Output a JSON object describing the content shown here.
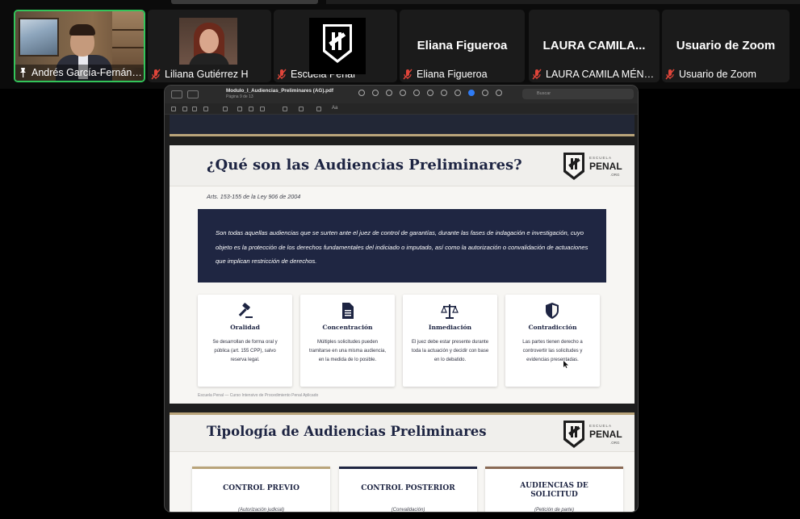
{
  "participants": [
    {
      "name": "Andrés García-Fernán…",
      "video": true,
      "pinned": true,
      "muted": false,
      "active_speaker": true
    },
    {
      "name": "Liliana Gutiérrez H",
      "video": true,
      "muted": true
    },
    {
      "name": "Escuela Penal",
      "video": false,
      "logo": true,
      "muted": true
    },
    {
      "name": "Eliana Figueroa",
      "display_name": "Eliana Figueroa",
      "video": false,
      "muted": true
    },
    {
      "name": "LAURA CAMILA MÉN…",
      "display_name": "LAURA CAMILA...",
      "video": false,
      "muted": true
    },
    {
      "name": "Usuario de Zoom",
      "display_name": "Usuario de Zoom",
      "video": false,
      "muted": true
    }
  ],
  "viewer": {
    "filename": "Modulo_I_Audiencias_Preliminares (AG).pdf",
    "page_info": "Página 9 de 13",
    "search_placeholder": "Buscar",
    "text_size_label": "Aa"
  },
  "slide1": {
    "title": "¿Qué son las Audiencias Preliminares?",
    "logo_top": "ESCUELA",
    "logo_main": "PENAL",
    "logo_sub": ".ORG",
    "legal_ref": "Arts. 153-155 de la Ley 906 de 2004",
    "definition": "Son todas aquellas audiencias que se surten ante el juez de control de garantías, durante las fases de indagación e investigación, cuyo objeto es la protección de los derechos fundamentales del indiciado o imputado, así como la autorización o convalidación de actuaciones que implican restricción de derechos.",
    "principles": [
      {
        "icon": "gavel-icon",
        "title": "Oralidad",
        "text": "Se desarrollan de forma oral y pública (art. 155 CPP), salvo reserva legal."
      },
      {
        "icon": "document-icon",
        "title": "Concentración",
        "text": "Múltiples solicitudes pueden tramitarse en una misma audiencia, en la medida de lo posible."
      },
      {
        "icon": "scales-icon",
        "title": "Inmediación",
        "text": "El juez debe estar presente durante toda la actuación y decidir con base en lo debatido."
      },
      {
        "icon": "shield-icon",
        "title": "Contradicción",
        "text": "Las partes tienen derecho a controvertir las solicitudes y evidencias presentadas."
      }
    ],
    "footer": "Escuela Penal — Curso Intensivo de Procedimiento Penal Aplicado"
  },
  "slide2": {
    "title": "Tipología de Audiencias Preliminares",
    "logo_top": "ESCUELA",
    "logo_main": "PENAL",
    "logo_sub": ".ORG",
    "types": [
      {
        "title": "CONTROL PREVIO",
        "subtitle": "(Autorización judicial)",
        "color": "#b9a47a"
      },
      {
        "title": "CONTROL POSTERIOR",
        "subtitle": "(Convalidación)",
        "color": "#1f2642"
      },
      {
        "title": "AUDIENCIAS DE SOLICITUD",
        "subtitle": "(Petición de parte)",
        "color": "#8a6a55"
      }
    ]
  },
  "colors": {
    "accent_gold": "#b9a47a",
    "navy": "#1f2642",
    "active_speaker": "#33c45a",
    "muted_red": "#e0453a"
  }
}
